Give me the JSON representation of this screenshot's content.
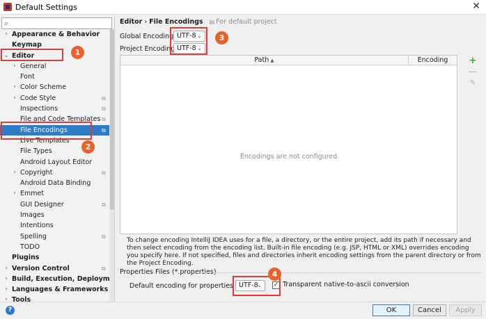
{
  "window": {
    "title": "Default Settings",
    "close_glyph": "✕"
  },
  "search": {
    "placeholder": "",
    "value": ""
  },
  "tree": [
    {
      "label": "Appearance & Behavior",
      "level": 0,
      "arrow": "›",
      "bold": true,
      "copy": false
    },
    {
      "label": "Keymap",
      "level": 0,
      "arrow": "",
      "bold": true,
      "copy": false
    },
    {
      "label": "Editor",
      "level": 0,
      "arrow": "⌄",
      "bold": true,
      "copy": false
    },
    {
      "label": "General",
      "level": 1,
      "arrow": "›",
      "bold": false,
      "copy": false
    },
    {
      "label": "Font",
      "level": 1,
      "arrow": "",
      "bold": false,
      "copy": false
    },
    {
      "label": "Color Scheme",
      "level": 1,
      "arrow": "›",
      "bold": false,
      "copy": false
    },
    {
      "label": "Code Style",
      "level": 1,
      "arrow": "›",
      "bold": false,
      "copy": true
    },
    {
      "label": "Inspections",
      "level": 1,
      "arrow": "",
      "bold": false,
      "copy": true
    },
    {
      "label": "File and Code Templates",
      "level": 1,
      "arrow": "",
      "bold": false,
      "copy": true
    },
    {
      "label": "File Encodings",
      "level": 1,
      "arrow": "",
      "bold": false,
      "copy": true,
      "selected": true
    },
    {
      "label": "Live Templates",
      "level": 1,
      "arrow": "",
      "bold": false,
      "copy": false
    },
    {
      "label": "File Types",
      "level": 1,
      "arrow": "",
      "bold": false,
      "copy": false
    },
    {
      "label": "Android Layout Editor",
      "level": 1,
      "arrow": "",
      "bold": false,
      "copy": false
    },
    {
      "label": "Copyright",
      "level": 1,
      "arrow": "›",
      "bold": false,
      "copy": true
    },
    {
      "label": "Android Data Binding",
      "level": 1,
      "arrow": "",
      "bold": false,
      "copy": false
    },
    {
      "label": "Emmet",
      "level": 1,
      "arrow": "›",
      "bold": false,
      "copy": false
    },
    {
      "label": "GUI Designer",
      "level": 1,
      "arrow": "",
      "bold": false,
      "copy": true
    },
    {
      "label": "Images",
      "level": 1,
      "arrow": "",
      "bold": false,
      "copy": false
    },
    {
      "label": "Intentions",
      "level": 1,
      "arrow": "",
      "bold": false,
      "copy": false
    },
    {
      "label": "Spelling",
      "level": 1,
      "arrow": "",
      "bold": false,
      "copy": true
    },
    {
      "label": "TODO",
      "level": 1,
      "arrow": "",
      "bold": false,
      "copy": false
    },
    {
      "label": "Plugins",
      "level": 0,
      "arrow": "",
      "bold": true,
      "copy": false
    },
    {
      "label": "Version Control",
      "level": 0,
      "arrow": "›",
      "bold": true,
      "copy": true
    },
    {
      "label": "Build, Execution, Deployment",
      "level": 0,
      "arrow": "›",
      "bold": true,
      "copy": false
    },
    {
      "label": "Languages & Frameworks",
      "level": 0,
      "arrow": "›",
      "bold": true,
      "copy": false
    },
    {
      "label": "Tools",
      "level": 0,
      "arrow": "›",
      "bold": true,
      "copy": false
    }
  ],
  "breadcrumb": {
    "parent": "Editor",
    "separator": "›",
    "current": "File Encodings",
    "note": "For default project"
  },
  "global_encoding": {
    "label": "Global Encoding:",
    "value": "UTF-8"
  },
  "project_encoding": {
    "label": "Project Encoding:",
    "value": "UTF-8"
  },
  "table": {
    "col_path": "Path",
    "col_encoding": "Encoding",
    "sort_glyph": "▲",
    "empty_text": "Encodings are not configured"
  },
  "tools": {
    "add": "+",
    "remove": "—",
    "edit": "✎"
  },
  "help_text": "To change encoding IntelliJ IDEA uses for a file, a directory, or the entire project, add its path if necessary and then select encoding from the encoding list. Built-in file encoding (e.g. JSP, HTML or XML) overrides encoding you specify here. If not specified, files and directories inherit encoding settings from the parent directory or from the Project Encoding.",
  "properties": {
    "group_title": "Properties Files (*.properties)",
    "default_label": "Default encoding for properties files:",
    "default_value": "UTF-8",
    "native_label": "Transparent native-to-ascii conversion",
    "native_checked": true
  },
  "buttons": {
    "help": "?",
    "ok": "OK",
    "cancel": "Cancel",
    "apply": "Apply"
  },
  "annotations": [
    "1",
    "2",
    "3",
    "4"
  ],
  "colors": {
    "selection": "#2f7cc6",
    "highlight": "#e53935",
    "badge": "#e8632b",
    "add": "#3aa33a"
  }
}
